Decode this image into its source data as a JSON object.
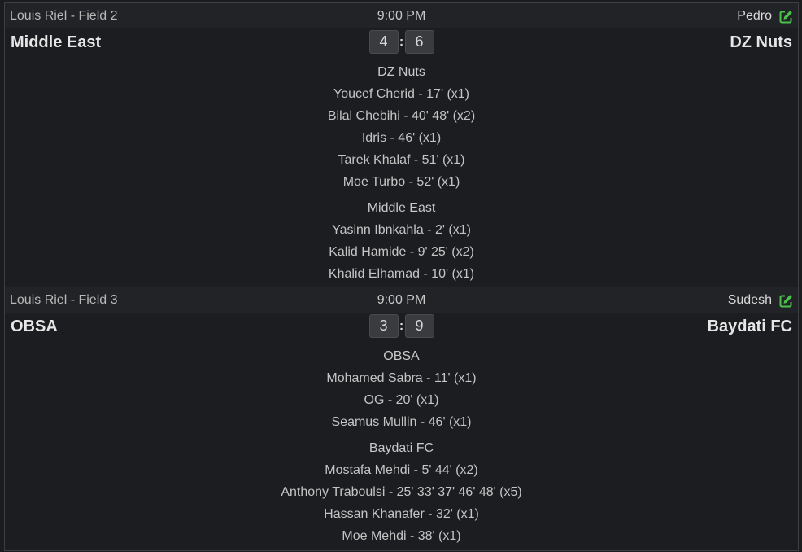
{
  "games": [
    {
      "field": "Louis Riel - Field 2",
      "time": "9:00 PM",
      "referee": "Pedro",
      "home_team": "Middle East",
      "away_team": "DZ Nuts",
      "home_score": "4",
      "away_score": "6",
      "score_separator": ":",
      "scorer_groups": [
        {
          "team": "DZ Nuts",
          "goals": [
            "Youcef Cherid - 17' (x1)",
            "Bilal Chebihi - 40' 48' (x2)",
            "Idris - 46' (x1)",
            "Tarek Khalaf - 51' (x1)",
            "Moe Turbo - 52' (x1)"
          ]
        },
        {
          "team": "Middle East",
          "goals": [
            "Yasinn Ibnkahla - 2' (x1)",
            "Kalid Hamide - 9' 25' (x2)",
            "Khalid Elhamad - 10' (x1)"
          ]
        }
      ]
    },
    {
      "field": "Louis Riel - Field 3",
      "time": "9:00 PM",
      "referee": "Sudesh",
      "home_team": "OBSA",
      "away_team": "Baydati FC",
      "home_score": "3",
      "away_score": "9",
      "score_separator": ":",
      "scorer_groups": [
        {
          "team": "OBSA",
          "goals": [
            "Mohamed Sabra - 11' (x1)",
            "OG - 20' (x1)",
            "Seamus Mullin - 46' (x1)"
          ]
        },
        {
          "team": "Baydati FC",
          "goals": [
            "Mostafa Mehdi - 5' 44' (x2)",
            "Anthony Traboulsi - 25' 33' 37' 46' 48' (x5)",
            "Hassan Khanafer - 32' (x1)",
            "Moe Mehdi - 38' (x1)"
          ]
        }
      ]
    }
  ],
  "icons": {
    "edit": "edit-icon"
  },
  "colors": {
    "edit_icon": "#4cc04c",
    "background": "#1b1c1e",
    "score_box": "#3a3b3e"
  }
}
